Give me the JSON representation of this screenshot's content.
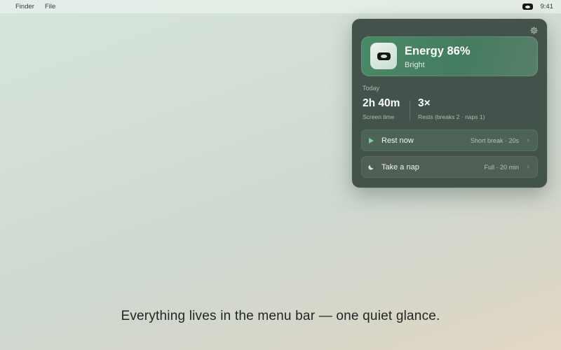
{
  "menubar": {
    "items": [
      "Finder",
      "File"
    ],
    "status_icon": "eye-icon",
    "clock": "9:41"
  },
  "panel": {
    "settings_icon": "gear-icon",
    "energy": {
      "title": "Energy 86%",
      "level_percent": 86,
      "state": "Bright",
      "icon": "eye-icon"
    },
    "today_label": "Today",
    "stats": [
      {
        "value": "2h 40m",
        "caption": "Screen time"
      },
      {
        "value": "3×",
        "caption": "Rests (breaks 2 · naps 1)"
      }
    ],
    "actions": [
      {
        "label": "Rest now",
        "meta": "Short break · 20s",
        "icon": "play-icon",
        "chevron": "›"
      },
      {
        "label": "Take a nap",
        "meta": "Full · 20 min",
        "icon": "moon-icon",
        "chevron": "›"
      }
    ]
  },
  "tagline": "Everything lives in the menu bar — one quiet glance.",
  "colors": {
    "panel_bg": "#43524a",
    "energy_card": "#4a8a68",
    "accent": "#7fd0a0"
  }
}
